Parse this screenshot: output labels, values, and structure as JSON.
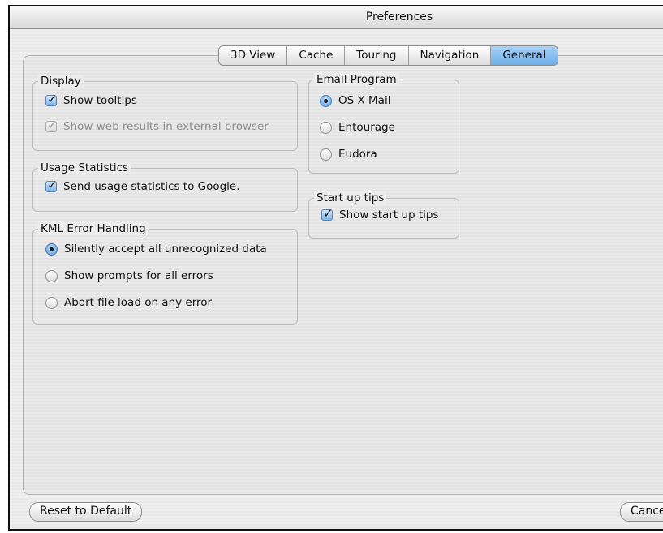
{
  "window": {
    "title": "Preferences"
  },
  "tabs": [
    {
      "label": "3D View"
    },
    {
      "label": "Cache"
    },
    {
      "label": "Touring"
    },
    {
      "label": "Navigation"
    },
    {
      "label": "General"
    }
  ],
  "active_tab": "General",
  "display": {
    "title": "Display",
    "show_tooltips": {
      "label": "Show tooltips",
      "checked": true
    },
    "show_web_results": {
      "label": "Show web results in external browser",
      "checked": true,
      "enabled": false
    }
  },
  "usage_statistics": {
    "title": "Usage Statistics",
    "send_stats": {
      "label": "Send usage statistics to Google.",
      "checked": true
    }
  },
  "kml_error_handling": {
    "title": "KML Error Handling",
    "options": [
      {
        "label": "Silently accept all unrecognized data",
        "selected": true
      },
      {
        "label": "Show prompts for all errors",
        "selected": false
      },
      {
        "label": "Abort file load on any error",
        "selected": false
      }
    ]
  },
  "email_program": {
    "title": "Email Program",
    "options": [
      {
        "label": "OS X Mail",
        "selected": true
      },
      {
        "label": "Entourage",
        "selected": false
      },
      {
        "label": "Eudora",
        "selected": false
      }
    ]
  },
  "startup_tips": {
    "title": "Start up tips",
    "show_tips": {
      "label": "Show start up tips",
      "checked": true
    }
  },
  "buttons": {
    "reset": "Reset to Default",
    "cancel": "Cancel"
  },
  "colors": {
    "accent": "#6caee8",
    "window_bg": "#ececec"
  }
}
